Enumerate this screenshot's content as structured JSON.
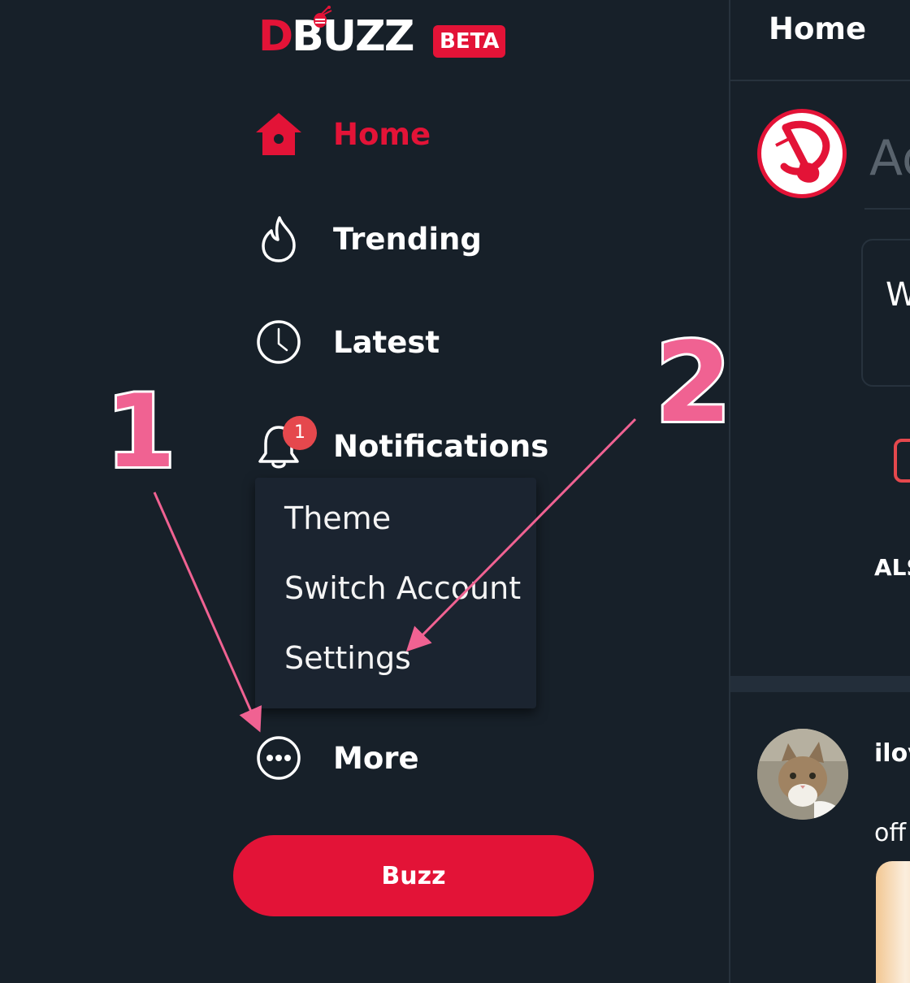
{
  "logo": {
    "first_letter": "D",
    "rest": "BUZZ",
    "badge": "BETA"
  },
  "sidebar": {
    "items": [
      {
        "label": "Home",
        "icon": "home-icon",
        "active": true
      },
      {
        "label": "Trending",
        "icon": "flame-icon"
      },
      {
        "label": "Latest",
        "icon": "clock-icon"
      },
      {
        "label": "Notifications",
        "icon": "bell-icon",
        "badge": "1"
      },
      {
        "label": "More",
        "icon": "more-icon"
      }
    ],
    "dropdown": [
      "Theme",
      "Switch Account",
      "Settings"
    ],
    "buzz_button": "Buzz"
  },
  "header": {
    "title": "Home"
  },
  "compose": {
    "placeholder_partial": "Ad",
    "box_text_partial": "W",
    "also_text_partial": "ALS"
  },
  "post": {
    "author_partial": "ilov",
    "text_partial": "off"
  },
  "annotations": {
    "one": "1",
    "two": "2"
  },
  "colors": {
    "background": "#172029",
    "accent": "#e31337",
    "annotation": "#f06292",
    "dropdown_bg": "#1b2430"
  }
}
